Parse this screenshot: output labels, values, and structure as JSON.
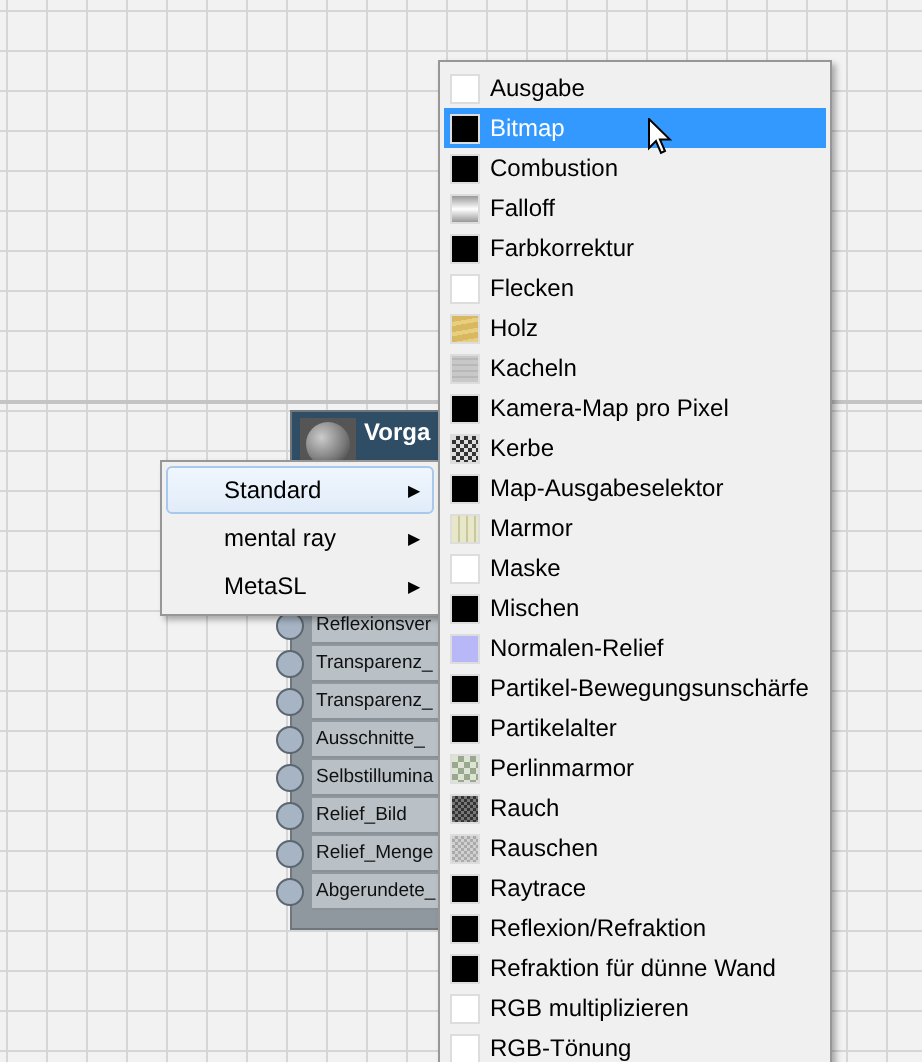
{
  "node": {
    "title": "Vorga",
    "ports": [
      "Reflexionsver",
      "Transparenz_",
      "Transparenz_",
      "Ausschnitte_",
      "Selbstillumina",
      "Relief_Bild",
      "Relief_Menge",
      "Abgerundete_"
    ]
  },
  "submenu": {
    "items": [
      {
        "label": "Standard",
        "selected": true,
        "arrow": "▶"
      },
      {
        "label": "mental ray",
        "selected": false,
        "arrow": "▶"
      },
      {
        "label": "MetaSL",
        "selected": false,
        "arrow": "▶"
      }
    ]
  },
  "menu": {
    "items": [
      {
        "label": "Ausgabe",
        "kind": "white",
        "selected": false
      },
      {
        "label": "Bitmap",
        "kind": "black",
        "selected": true
      },
      {
        "label": "Combustion",
        "kind": "black",
        "selected": false
      },
      {
        "label": "Falloff",
        "kind": "gradient",
        "selected": false
      },
      {
        "label": "Farbkorrektur",
        "kind": "black",
        "selected": false
      },
      {
        "label": "Flecken",
        "kind": "white",
        "selected": false
      },
      {
        "label": "Holz",
        "kind": "wood",
        "selected": false
      },
      {
        "label": "Kacheln",
        "kind": "tiles",
        "selected": false
      },
      {
        "label": "Kamera-Map pro Pixel",
        "kind": "black",
        "selected": false
      },
      {
        "label": "Kerbe",
        "kind": "checker",
        "selected": false
      },
      {
        "label": "Map-Ausgabeselektor",
        "kind": "black",
        "selected": false
      },
      {
        "label": "Marmor",
        "kind": "marble",
        "selected": false
      },
      {
        "label": "Maske",
        "kind": "white",
        "selected": false
      },
      {
        "label": "Mischen",
        "kind": "black",
        "selected": false
      },
      {
        "label": "Normalen-Relief",
        "kind": "lavender",
        "selected": false
      },
      {
        "label": "Partikel-Bewegungsunschärfe",
        "kind": "black",
        "selected": false
      },
      {
        "label": "Partikelalter",
        "kind": "black",
        "selected": false
      },
      {
        "label": "Perlinmarmor",
        "kind": "perlin",
        "selected": false
      },
      {
        "label": "Rauch",
        "kind": "smoke",
        "selected": false
      },
      {
        "label": "Rauschen",
        "kind": "noise",
        "selected": false
      },
      {
        "label": "Raytrace",
        "kind": "black",
        "selected": false
      },
      {
        "label": "Reflexion/Refraktion",
        "kind": "black",
        "selected": false
      },
      {
        "label": "Refraktion für dünne Wand",
        "kind": "black",
        "selected": false
      },
      {
        "label": "RGB multiplizieren",
        "kind": "white",
        "selected": false
      },
      {
        "label": "RGB-Tönung",
        "kind": "white",
        "selected": false
      }
    ]
  }
}
